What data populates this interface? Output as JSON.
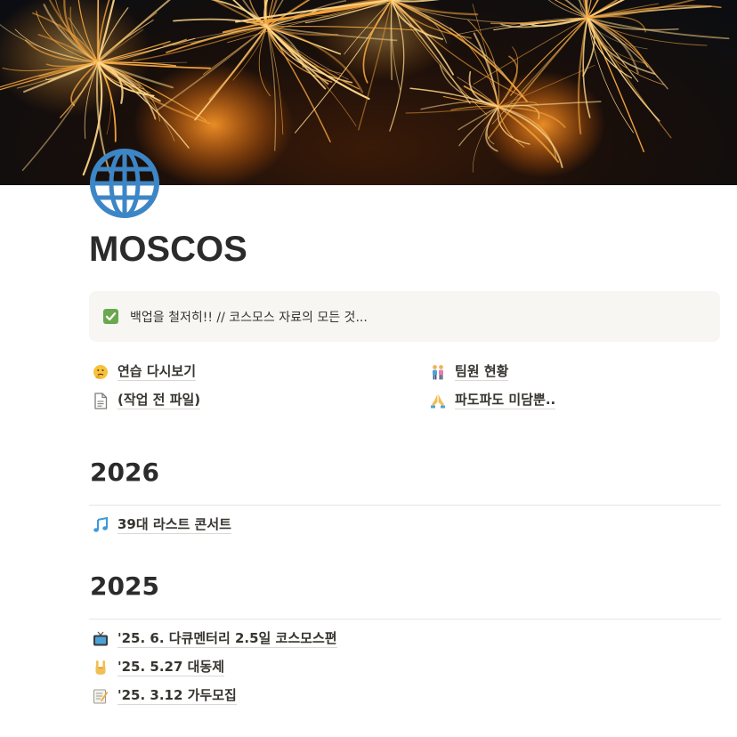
{
  "page": {
    "title": "MOSCOS",
    "page_icon": "globe-icon",
    "cover": "sparkler-fireworks-photo"
  },
  "callout": {
    "icon": "check-box-icon",
    "text": "백업을 철저히!! // 코스모스 자료의 모든 것..."
  },
  "links": {
    "left": [
      {
        "icon": "thinking-face-icon",
        "label": "연습 다시보기"
      },
      {
        "icon": "document-icon",
        "label": "(작업 전 파일)"
      }
    ],
    "right": [
      {
        "icon": "people-icon",
        "label": "팀원 현황"
      },
      {
        "icon": "praying-hands-icon",
        "label": "파도파도 미담뿐.."
      }
    ]
  },
  "sections": [
    {
      "heading": "2026",
      "items": [
        {
          "icon": "music-note-icon",
          "label": "39대 라스트 콘서트"
        }
      ]
    },
    {
      "heading": "2025",
      "items": [
        {
          "icon": "television-icon",
          "label": "'25. 6. 다큐멘터리 2.5일 코스모스편"
        },
        {
          "icon": "rock-hand-icon",
          "label": "'25. 5.27 대동제"
        },
        {
          "icon": "memo-icon",
          "label": "'25. 3.12 가두모집"
        }
      ]
    }
  ],
  "colors": {
    "text": "#37352f",
    "callout_bg": "#f7f6f3",
    "check_green": "#6aa84f",
    "globe_blue": "#3d86c6"
  }
}
